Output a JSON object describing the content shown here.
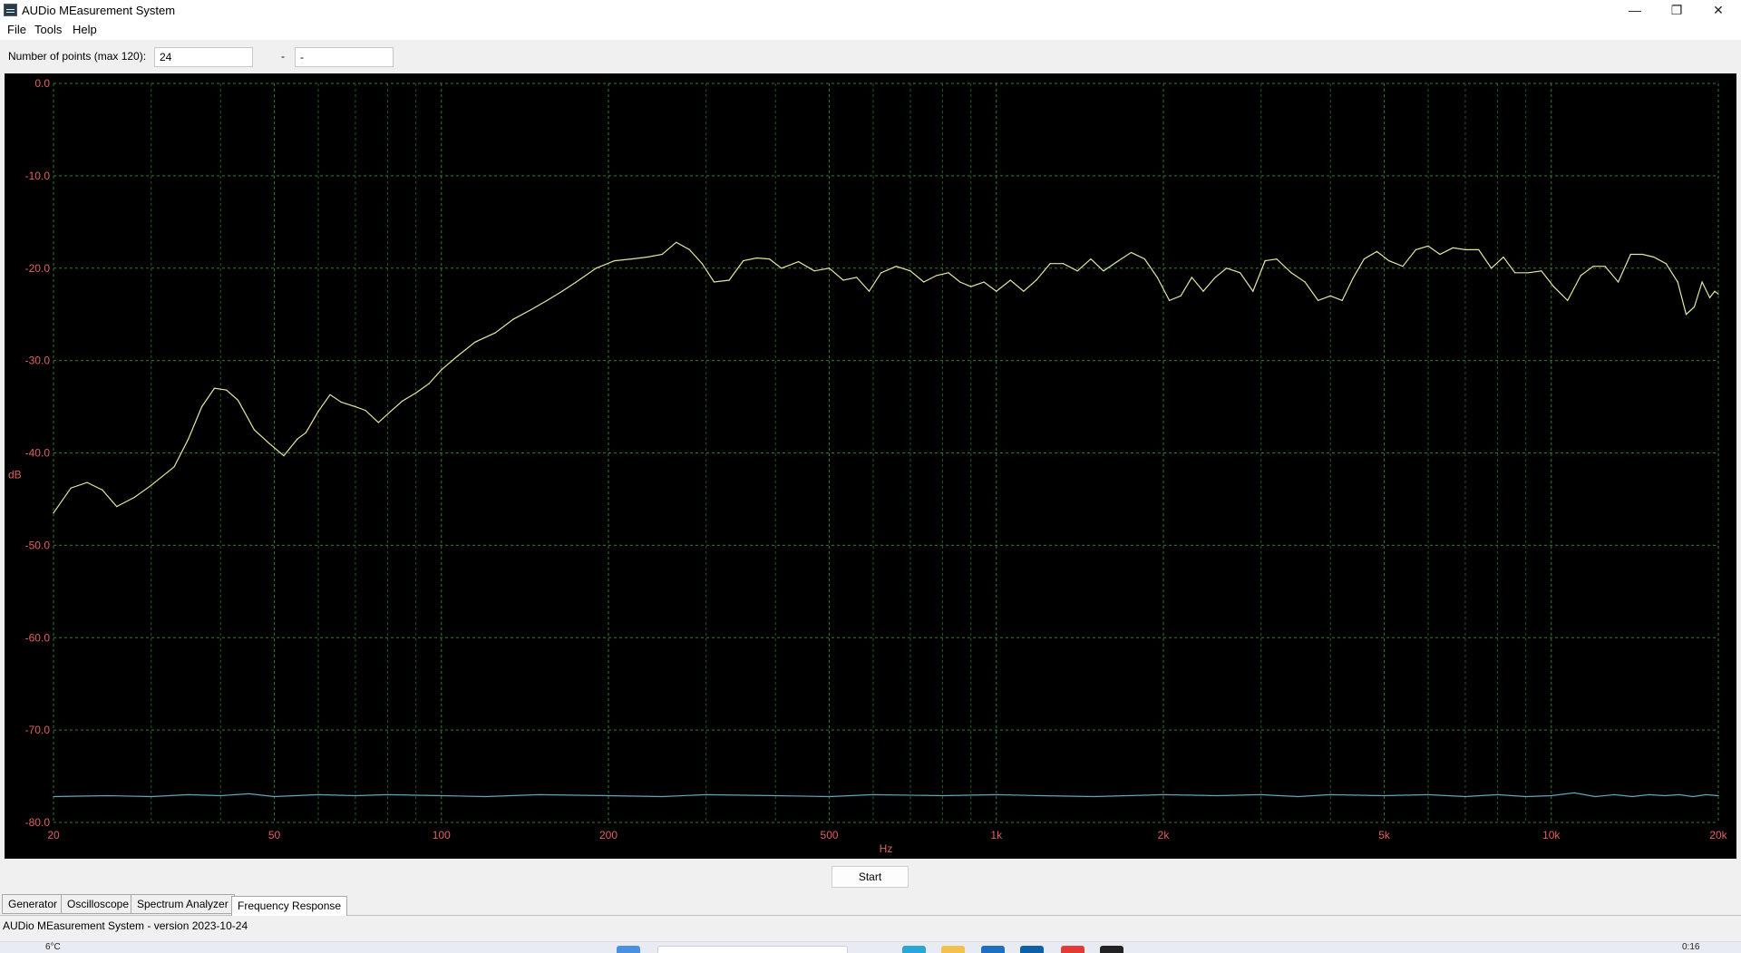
{
  "window": {
    "title": "AUDio MEasurement System",
    "minimize_glyph": "—",
    "restore_glyph": "❐",
    "close_glyph": "✕"
  },
  "menu": [
    "File",
    "Tools",
    "Help"
  ],
  "toolbar": {
    "points_label": "Number of points (max 120):",
    "points_value": "24",
    "dash": "-",
    "second_value": "-"
  },
  "chart_data": {
    "type": "line",
    "xlabel": "Hz",
    "ylabel": "dB",
    "xscale": "log",
    "xlim": [
      20,
      20000
    ],
    "ylim": [
      -80,
      0
    ],
    "grid": true,
    "x_tick_labels": [
      {
        "value": 20,
        "label": "20"
      },
      {
        "value": 50,
        "label": "50"
      },
      {
        "value": 100,
        "label": "100"
      },
      {
        "value": 200,
        "label": "200"
      },
      {
        "value": 500,
        "label": "500"
      },
      {
        "value": 1000,
        "label": "1k"
      },
      {
        "value": 2000,
        "label": "2k"
      },
      {
        "value": 5000,
        "label": "5k"
      },
      {
        "value": 10000,
        "label": "10k"
      },
      {
        "value": 20000,
        "label": "20k"
      }
    ],
    "y_tick_labels": [
      {
        "value": 0,
        "label": "0.0"
      },
      {
        "value": -10,
        "label": "-10.0"
      },
      {
        "value": -20,
        "label": "-20.0"
      },
      {
        "value": -30,
        "label": "-30.0"
      },
      {
        "value": -40,
        "label": "-40.0"
      },
      {
        "value": -50,
        "label": "-50.0"
      },
      {
        "value": -60,
        "label": "-60.0"
      },
      {
        "value": -70,
        "label": "-70.0"
      },
      {
        "value": -80,
        "label": "-80.0"
      }
    ],
    "series": [
      {
        "color": "#e6e6a0",
        "points": [
          [
            20,
            -46.5
          ],
          [
            21.5,
            -43.8
          ],
          [
            23,
            -43.2
          ],
          [
            24.5,
            -44
          ],
          [
            26,
            -45.8
          ],
          [
            28,
            -44.8
          ],
          [
            30,
            -43.5
          ],
          [
            33,
            -41.5
          ],
          [
            35,
            -38.5
          ],
          [
            37,
            -35
          ],
          [
            39,
            -33
          ],
          [
            41,
            -33.2
          ],
          [
            43,
            -34.3
          ],
          [
            46,
            -37.5
          ],
          [
            49,
            -39
          ],
          [
            52,
            -40.3
          ],
          [
            55,
            -38.5
          ],
          [
            57,
            -37.8
          ],
          [
            60,
            -35.5
          ],
          [
            63,
            -33.7
          ],
          [
            66,
            -34.5
          ],
          [
            70,
            -35
          ],
          [
            73,
            -35.4
          ],
          [
            77,
            -36.7
          ],
          [
            81,
            -35.5
          ],
          [
            85,
            -34.4
          ],
          [
            90,
            -33.5
          ],
          [
            95,
            -32.5
          ],
          [
            100,
            -31
          ],
          [
            107,
            -29.5
          ],
          [
            115,
            -28
          ],
          [
            125,
            -27
          ],
          [
            135,
            -25.5
          ],
          [
            145,
            -24.5
          ],
          [
            155,
            -23.5
          ],
          [
            165,
            -22.5
          ],
          [
            175,
            -21.5
          ],
          [
            190,
            -20
          ],
          [
            205,
            -19.2
          ],
          [
            220,
            -19
          ],
          [
            235,
            -18.8
          ],
          [
            250,
            -18.5
          ],
          [
            265,
            -17.2
          ],
          [
            280,
            -18
          ],
          [
            295,
            -19.5
          ],
          [
            310,
            -21.5
          ],
          [
            330,
            -21.3
          ],
          [
            350,
            -19.2
          ],
          [
            370,
            -18.9
          ],
          [
            390,
            -19
          ],
          [
            410,
            -20
          ],
          [
            440,
            -19.3
          ],
          [
            470,
            -20.3
          ],
          [
            500,
            -20
          ],
          [
            530,
            -21.3
          ],
          [
            560,
            -21
          ],
          [
            590,
            -22.5
          ],
          [
            620,
            -20.5
          ],
          [
            660,
            -19.8
          ],
          [
            700,
            -20.3
          ],
          [
            740,
            -21.5
          ],
          [
            780,
            -20.8
          ],
          [
            820,
            -20.5
          ],
          [
            860,
            -21.5
          ],
          [
            900,
            -22
          ],
          [
            950,
            -21.5
          ],
          [
            1000,
            -22.5
          ],
          [
            1060,
            -21.3
          ],
          [
            1120,
            -22.5
          ],
          [
            1180,
            -21.3
          ],
          [
            1250,
            -19.5
          ],
          [
            1320,
            -19.5
          ],
          [
            1400,
            -20.3
          ],
          [
            1480,
            -19
          ],
          [
            1560,
            -20.3
          ],
          [
            1650,
            -19.3
          ],
          [
            1750,
            -18.3
          ],
          [
            1850,
            -19
          ],
          [
            1950,
            -21
          ],
          [
            2050,
            -23.5
          ],
          [
            2150,
            -23
          ],
          [
            2250,
            -21
          ],
          [
            2360,
            -22.5
          ],
          [
            2480,
            -21
          ],
          [
            2600,
            -20
          ],
          [
            2750,
            -20.5
          ],
          [
            2900,
            -22.5
          ],
          [
            3050,
            -19.2
          ],
          [
            3200,
            -19
          ],
          [
            3400,
            -20.5
          ],
          [
            3600,
            -21.5
          ],
          [
            3800,
            -23.5
          ],
          [
            4000,
            -23
          ],
          [
            4200,
            -23.5
          ],
          [
            4400,
            -21
          ],
          [
            4600,
            -19
          ],
          [
            4850,
            -18.2
          ],
          [
            5100,
            -19.2
          ],
          [
            5400,
            -19.8
          ],
          [
            5700,
            -18
          ],
          [
            6000,
            -17.6
          ],
          [
            6300,
            -18.5
          ],
          [
            6650,
            -17.8
          ],
          [
            7000,
            -18
          ],
          [
            7400,
            -18
          ],
          [
            7800,
            -20
          ],
          [
            8200,
            -18.8
          ],
          [
            8600,
            -20.5
          ],
          [
            9100,
            -20.5
          ],
          [
            9600,
            -20.3
          ],
          [
            10100,
            -22
          ],
          [
            10700,
            -23.5
          ],
          [
            11300,
            -20.8
          ],
          [
            11900,
            -19.8
          ],
          [
            12500,
            -19.8
          ],
          [
            13200,
            -21.5
          ],
          [
            13900,
            -18.5
          ],
          [
            14600,
            -18.5
          ],
          [
            15300,
            -18.8
          ],
          [
            16100,
            -19.5
          ],
          [
            16900,
            -21.5
          ],
          [
            17500,
            -25
          ],
          [
            18100,
            -24.2
          ],
          [
            18700,
            -21.5
          ],
          [
            19300,
            -23.2
          ],
          [
            19700,
            -22.5
          ],
          [
            20000,
            -22.8
          ]
        ]
      },
      {
        "color": "#5fa8b8",
        "points": [
          [
            20,
            -77.2
          ],
          [
            25,
            -77.1
          ],
          [
            30,
            -77.2
          ],
          [
            35,
            -77
          ],
          [
            40,
            -77.1
          ],
          [
            45,
            -76.9
          ],
          [
            50,
            -77.2
          ],
          [
            60,
            -77
          ],
          [
            70,
            -77.1
          ],
          [
            80,
            -77
          ],
          [
            100,
            -77.1
          ],
          [
            120,
            -77.2
          ],
          [
            150,
            -77
          ],
          [
            200,
            -77.1
          ],
          [
            250,
            -77.2
          ],
          [
            300,
            -77
          ],
          [
            400,
            -77.1
          ],
          [
            500,
            -77.2
          ],
          [
            600,
            -77
          ],
          [
            800,
            -77.1
          ],
          [
            1000,
            -77
          ],
          [
            1200,
            -77.1
          ],
          [
            1500,
            -77.2
          ],
          [
            2000,
            -77
          ],
          [
            2500,
            -77.1
          ],
          [
            3000,
            -77
          ],
          [
            3500,
            -77.2
          ],
          [
            4000,
            -77
          ],
          [
            5000,
            -77.1
          ],
          [
            6000,
            -77
          ],
          [
            7000,
            -77.2
          ],
          [
            8000,
            -77
          ],
          [
            9000,
            -77.2
          ],
          [
            10000,
            -77.1
          ],
          [
            11000,
            -76.8
          ],
          [
            12000,
            -77.2
          ],
          [
            13000,
            -77
          ],
          [
            14000,
            -77.2
          ],
          [
            15000,
            -77
          ],
          [
            16000,
            -77.1
          ],
          [
            17000,
            -77
          ],
          [
            18000,
            -77.2
          ],
          [
            19000,
            -77
          ],
          [
            20000,
            -77.1
          ]
        ]
      }
    ]
  },
  "start_button": "Start",
  "tabs": [
    {
      "label": "Generator",
      "active": false
    },
    {
      "label": "Oscilloscope",
      "active": false
    },
    {
      "label": "Spectrum Analyzer",
      "active": false
    },
    {
      "label": "Frequency Response",
      "active": true
    }
  ],
  "status": "AUDio MEasurement System - version 2023-10-24",
  "taskbar": {
    "weather": "6°C",
    "clock": "0:16"
  }
}
